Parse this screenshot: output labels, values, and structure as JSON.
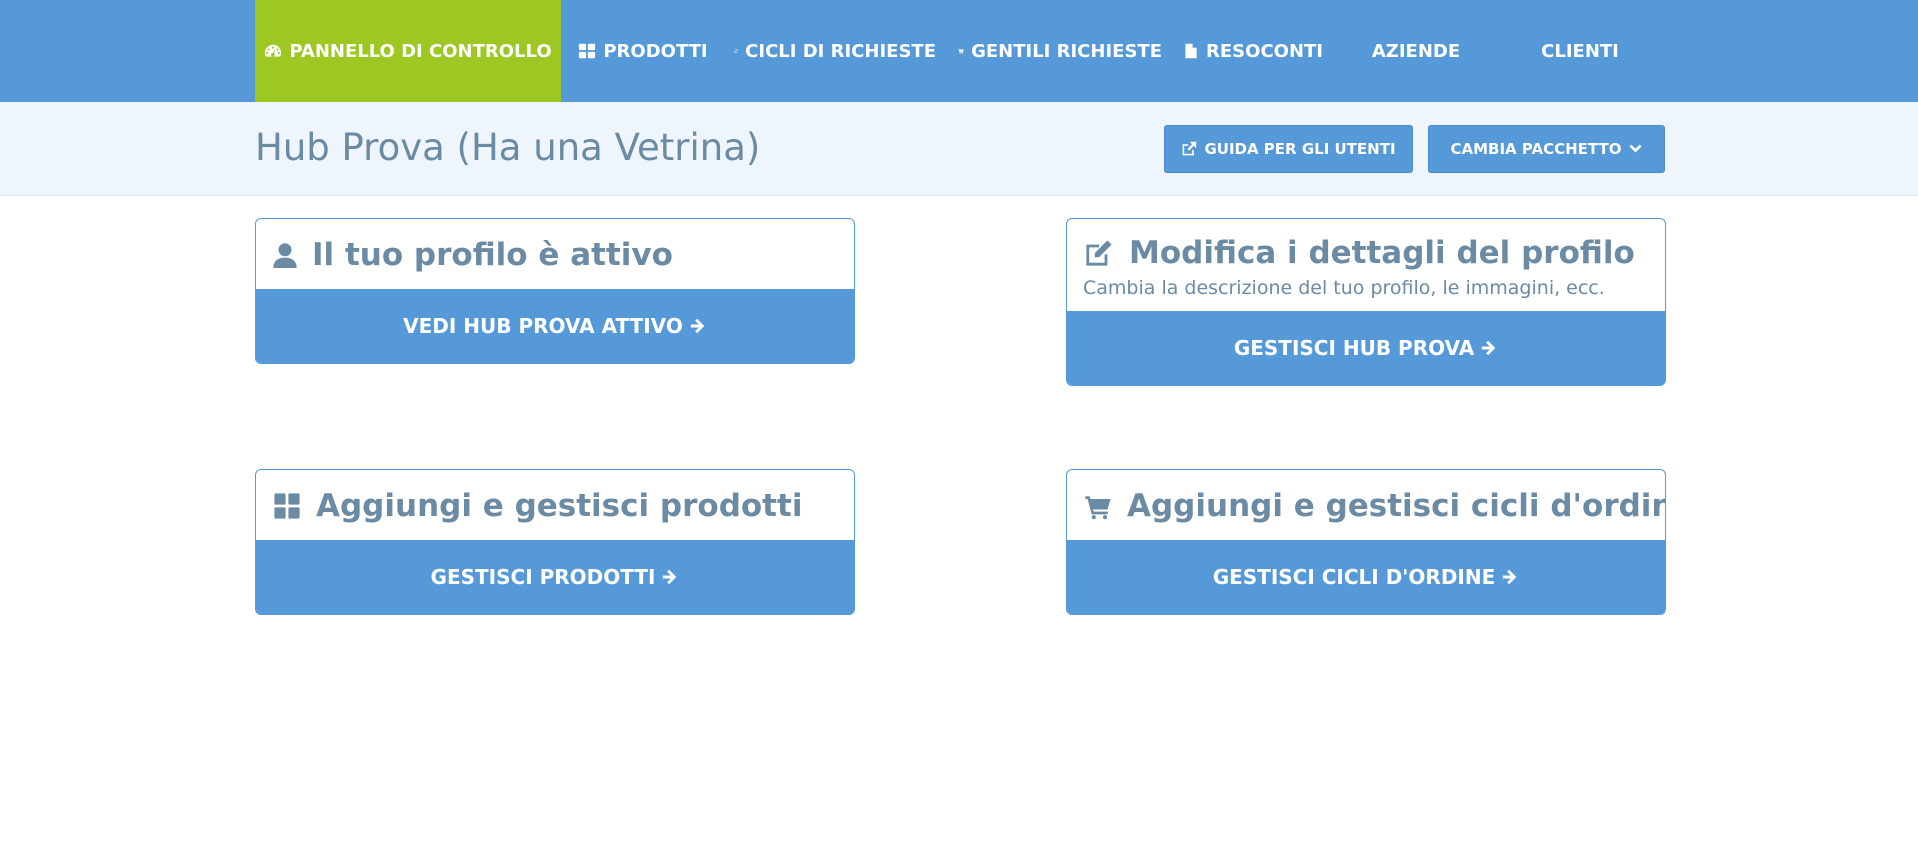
{
  "nav": {
    "dashboard": "PANNELLO DI CONTROLLO",
    "products": "PRODOTTI",
    "request_cycles": "CICLI DI RICHIESTE",
    "kind_requests": "GENTILI RICHIESTE",
    "reports": "RESOCONTI",
    "companies": "AZIENDE",
    "clients": "CLIENTI"
  },
  "header": {
    "title": "Hub Prova (Ha una Vetrina)",
    "guide_button": "GUIDA PER GLI UTENTI",
    "change_package_button": "CAMBIA PACCHETTO"
  },
  "cards": {
    "profile_active": {
      "title": "Il tuo profilo è attivo",
      "button": "VEDI HUB PROVA ATTIVO"
    },
    "edit_profile": {
      "title": "Modifica i dettagli del profilo",
      "subtitle": "Cambia la descrizione del tuo profilo, le immagini, ecc.",
      "button": "GESTISCI HUB PROVA"
    },
    "products": {
      "title": "Aggiungi e gestisci prodotti",
      "button": "GESTISCI PRODOTTI"
    },
    "order_cycles": {
      "title": "Aggiungi e gestisci cicli d'ordine",
      "button": "GESTISCI CICLI D'ORDINE"
    }
  },
  "colors": {
    "primary": "#5599d9",
    "active_nav": "#9dc823",
    "title_text": "#6b8aa3",
    "subheader_bg": "#eef5fc"
  }
}
